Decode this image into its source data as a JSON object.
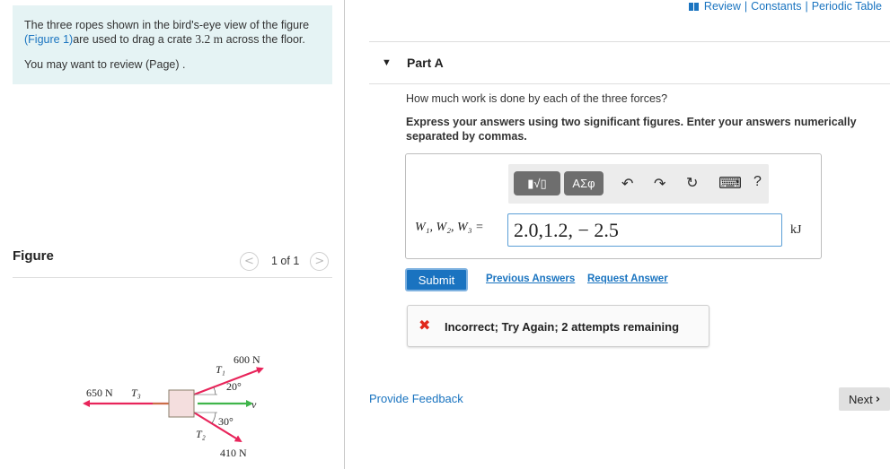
{
  "header": {
    "links": [
      "Review",
      "Constants",
      "Periodic Table"
    ]
  },
  "problem": {
    "text_before": "The three ropes shown in the bird's-eye view of the figure",
    "figure_link": "(Figure 1)",
    "text_after": "are used to drag a crate ",
    "distance": "3.2 m",
    "text_end": " across the floor.",
    "review_text": "You may want to review (Page) ."
  },
  "figure_panel": {
    "label": "Figure",
    "pager_text": "1 of 1",
    "prev_glyph": "<",
    "next_glyph": ">",
    "diagram": {
      "t1_label": "T₁",
      "t1_force": "600 N",
      "t1_angle": "20°",
      "t2_label": "T₂",
      "t2_force": "410 N",
      "t2_angle": "30°",
      "t3_label": "T₃",
      "t3_force": "650 N",
      "v_label": "v"
    }
  },
  "part": {
    "caret": "▼",
    "title": "Part A",
    "question": "How much work is done by each of the three forces?",
    "instruction": "Express your answers using two significant figures. Enter your answers numerically separated by commas."
  },
  "toolbar": {
    "template_label": "▮√▯",
    "greek_label": "ΑΣφ",
    "icons": [
      "undo-icon",
      "redo-icon",
      "reset-icon",
      "keyboard-icon",
      "help-icon"
    ],
    "undo_glyph": "↶",
    "redo_glyph": "↷",
    "reset_glyph": "↻",
    "keyboard_glyph": "⌨",
    "help_glyph": "?"
  },
  "answer": {
    "label": "W₁, W₂, W₃ =",
    "value": "2.0,1.2, − 2.5",
    "unit": "kJ"
  },
  "actions": {
    "submit": "Submit",
    "previous_answers": "Previous Answers",
    "request_answer": "Request Answer"
  },
  "feedback": {
    "icon": "✖",
    "text": "Incorrect; Try Again; 2 attempts remaining"
  },
  "footer": {
    "provide_feedback": "Provide Feedback",
    "next": "Next"
  },
  "colors": {
    "link": "#1a74c0",
    "problem_bg": "#e5f3f4",
    "submit_bg": "#1a73c0",
    "error": "#e0281c",
    "rope_arrow": "#e8245a",
    "velocity_arrow": "#3fb54a",
    "crate": "#f4dede"
  }
}
